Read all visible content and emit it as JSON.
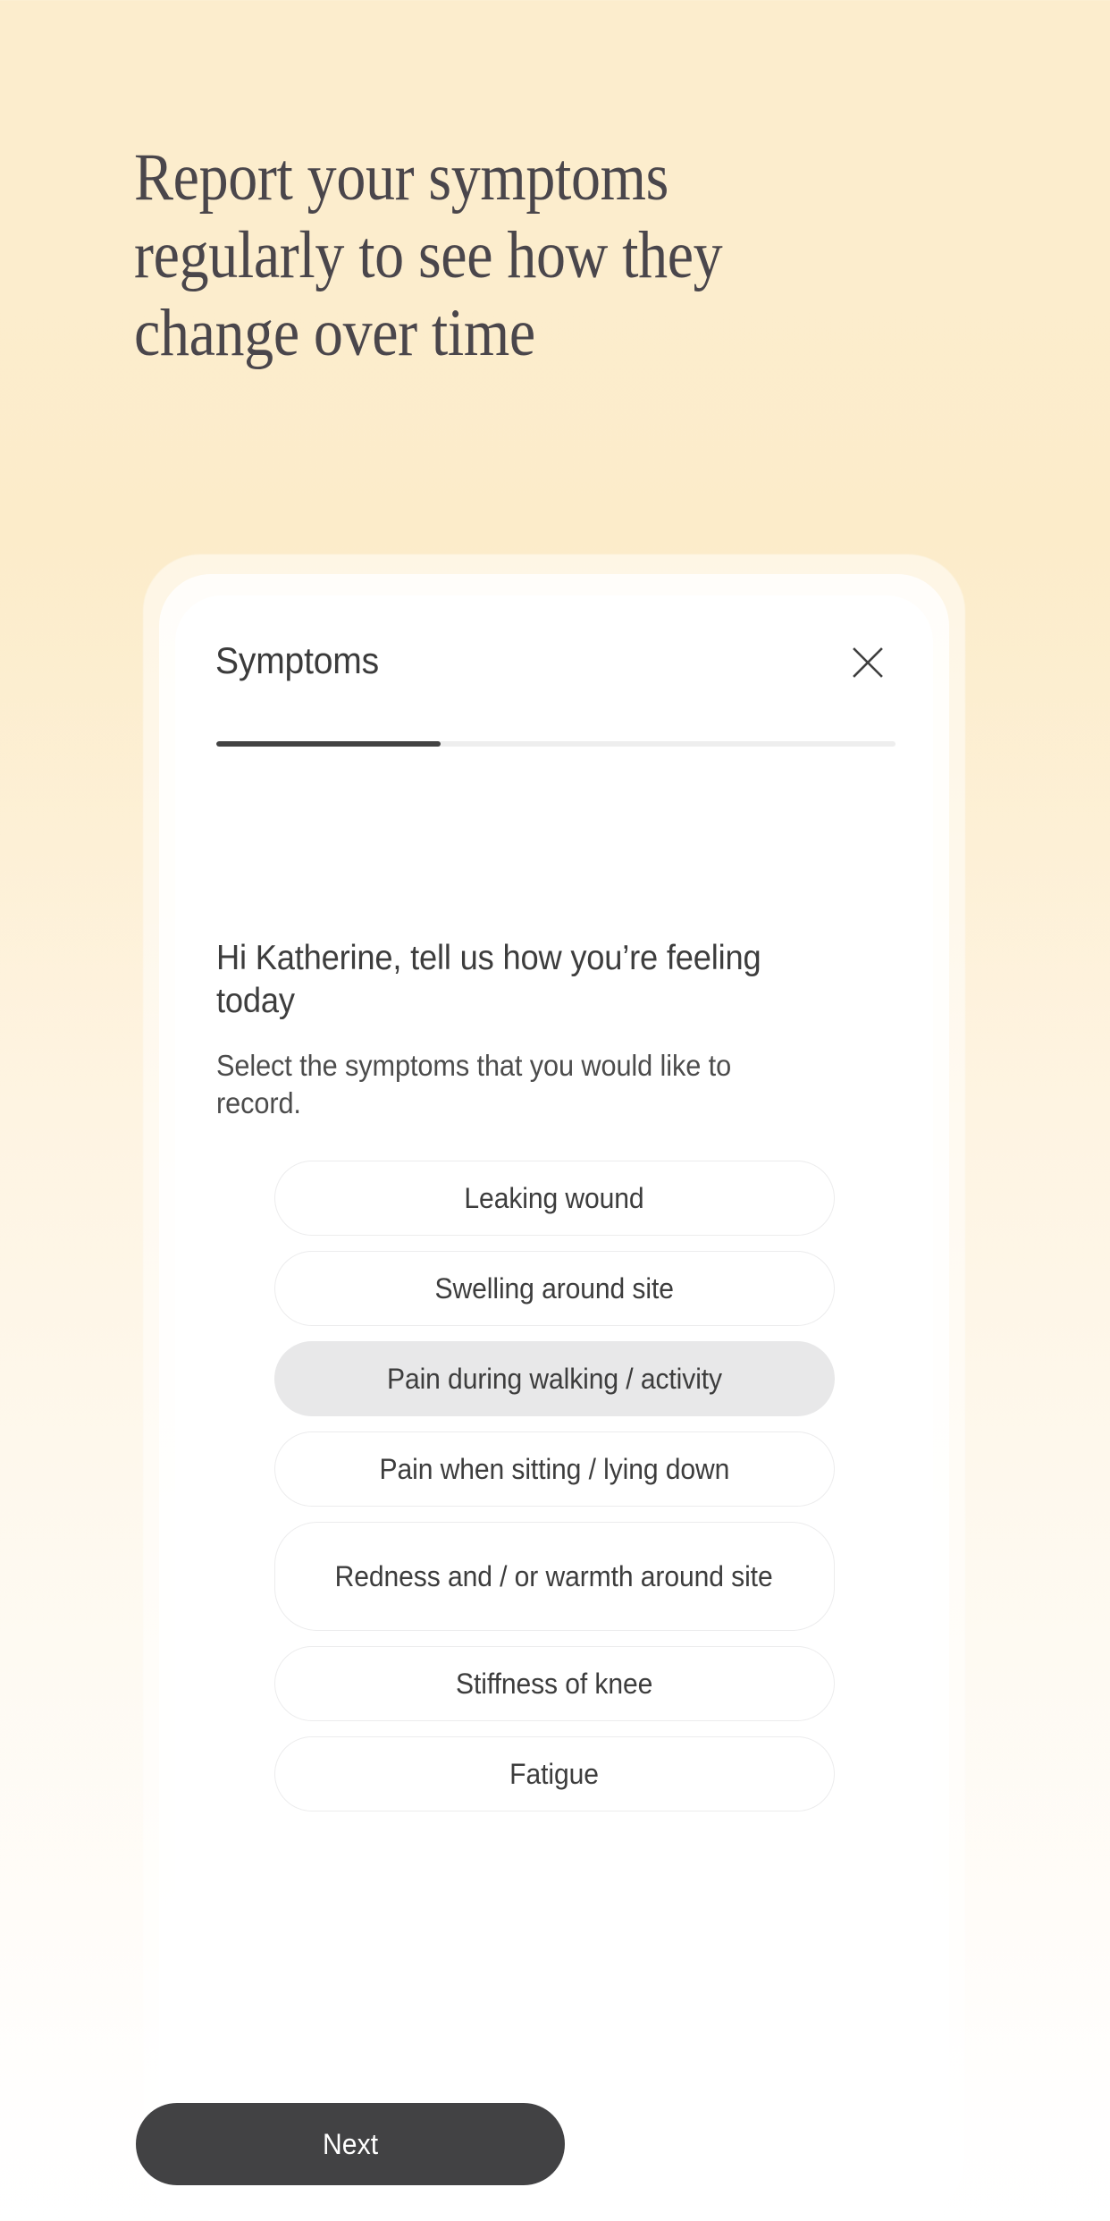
{
  "hero": {
    "title": "Report your symptoms\nregularly to see how they\nchange over time"
  },
  "card": {
    "title": "Symptoms",
    "close_icon": "close-icon",
    "progress": {
      "percent": 33,
      "fill_color": "#434343",
      "track_color": "#eeeeee"
    },
    "greeting": "Hi Katherine, tell us how you’re feeling today",
    "instruction": "Select the symptoms that you would like to record.",
    "symptoms": [
      {
        "label": "Leaking wound",
        "selected": false,
        "tall": false
      },
      {
        "label": "Swelling around site",
        "selected": false,
        "tall": false
      },
      {
        "label": "Pain during walking / activity",
        "selected": true,
        "tall": false
      },
      {
        "label": "Pain when sitting / lying down",
        "selected": false,
        "tall": false
      },
      {
        "label": "Redness and / or warmth around site",
        "selected": false,
        "tall": true
      },
      {
        "label": "Stiffness of knee",
        "selected": false,
        "tall": false
      },
      {
        "label": "Fatigue",
        "selected": false,
        "tall": false
      }
    ]
  },
  "footer": {
    "next_label": "Next"
  },
  "colors": {
    "background_top": "#fcedcd",
    "background_bottom": "#ffffff",
    "card_background": "#ffffff",
    "text_primary": "#3d3d3d",
    "hero_text": "#4a464b",
    "pill_border": "#ececed",
    "pill_selected_bg": "#e8e8e9",
    "button_bg": "#424244",
    "button_text": "#ffffff"
  }
}
